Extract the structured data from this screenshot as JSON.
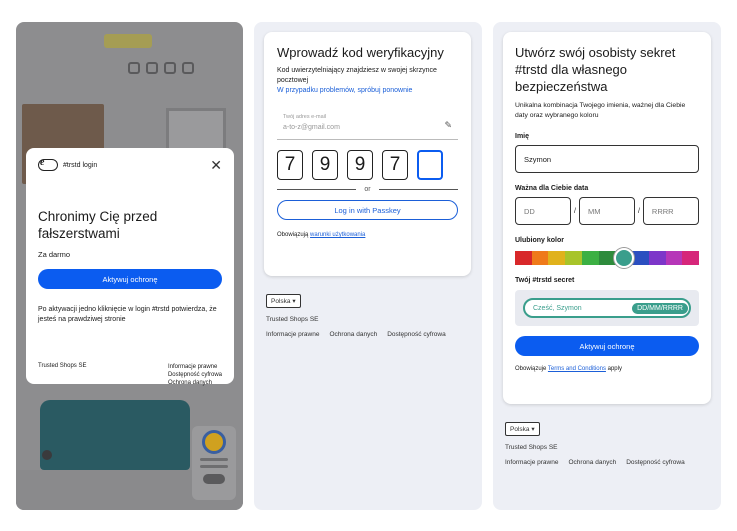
{
  "panel1": {
    "brand": "#trstd login",
    "title": "Chronimy Cię przed fałszerstwami",
    "subtitle": "Za darmo",
    "button": "Aktywuj ochronę",
    "description": "Po aktywacji jedno kliknięcie w login #trstd potwierdza, że jesteś na prawdziwej stronie",
    "company": "Trusted Shops SE",
    "links": [
      "Informacje prawne",
      "Dostępność cyfrowa",
      "Ochrona danych"
    ],
    "icons": {
      "logo": "trstd-toggle-icon",
      "close": "close-icon"
    }
  },
  "panel2": {
    "title": "Wprowadź kod weryfikacyjny",
    "info": "Kod uwierzytelniający znajdziesz w swojej skrzynce pocztowej",
    "problem_link": "W przypadku problemów, spróbuj ponownie",
    "email_label": "Twój adres e-mail",
    "email_value": "a-to-z@gmail.com",
    "code": [
      "7",
      "9",
      "9",
      "7",
      ""
    ],
    "or": "or",
    "passkey_button": "Log in with Passkey",
    "terms_prefix": "Obowiązują",
    "terms_link": "warunki użytkowania",
    "country": "Polska",
    "company": "Trusted Shops SE",
    "footer_links": [
      "Informacje prawne",
      "Ochrona danych",
      "Dostępność cyfrowa"
    ]
  },
  "panel3": {
    "title": "Utwórz swój osobisty sekret #trstd dla własnego bezpieczeństwa",
    "info": "Unikalna kombinacja Twojego imienia, ważnej dla Ciebie daty oraz wybranego koloru",
    "name_label": "Imię",
    "name_value": "Szymon",
    "date_label": "Ważna dla Ciebie data",
    "date_placeholders": [
      "DD",
      "MM",
      "RRRR"
    ],
    "color_label": "Ulubiony kolor",
    "colors": [
      "#d8282a",
      "#ef7a1a",
      "#e0b21c",
      "#a8c42a",
      "#3cb043",
      "#2e8b3c",
      "#3a9e8c",
      "#2b4fc0",
      "#7d36c9",
      "#b636b8",
      "#d6267a"
    ],
    "selected_color": "#3a9e8c",
    "secret_label": "Twój #trstd secret",
    "secret_name": "Cześć, Szymon",
    "secret_date": "DD/MM/RRRR",
    "button": "Aktywuj ochronę",
    "terms_prefix": "Obowiązuje",
    "terms_link": "Terms and Conditions",
    "terms_suffix": "apply",
    "country": "Polska",
    "company": "Trusted Shops SE",
    "footer_links": [
      "Informacje prawne",
      "Ochrona danych",
      "Dostępność cyfrowa"
    ]
  },
  "theme": {
    "primary": "#0b5cf0",
    "link": "#1b5fd8",
    "teal": "#3a9e8c"
  }
}
